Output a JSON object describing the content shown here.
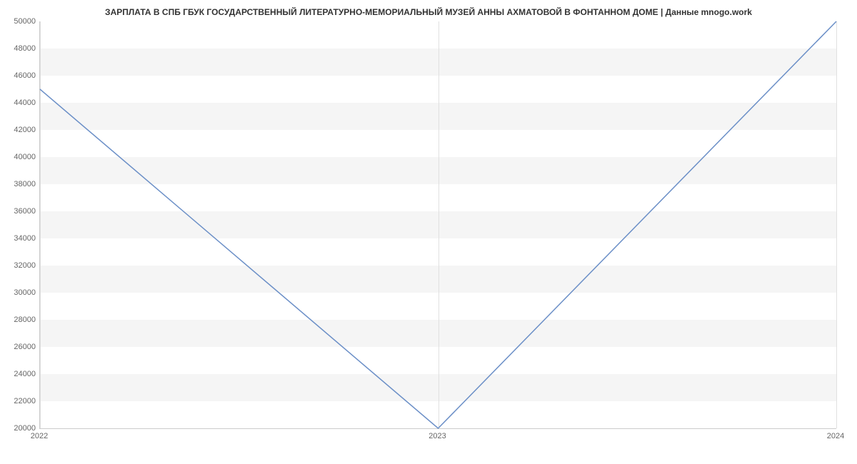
{
  "chart_data": {
    "type": "line",
    "title": "ЗАРПЛАТА В СПБ ГБУК ГОСУДАРСТВЕННЫЙ ЛИТЕРАТУРНО-МЕМОРИАЛЬНЫЙ МУЗЕЙ АННЫ АХМАТОВОЙ В ФОНТАННОМ ДОМЕ | Данные mnogo.work",
    "x": [
      2022,
      2023,
      2024
    ],
    "values": [
      45000,
      20000,
      50000
    ],
    "xlabel": "",
    "ylabel": "",
    "ylim": [
      20000,
      50000
    ],
    "y_ticks": [
      20000,
      22000,
      24000,
      26000,
      28000,
      30000,
      32000,
      34000,
      36000,
      38000,
      40000,
      42000,
      44000,
      46000,
      48000,
      50000
    ],
    "x_ticks": [
      2022,
      2023,
      2024
    ],
    "line_color": "#6b8fc7"
  }
}
